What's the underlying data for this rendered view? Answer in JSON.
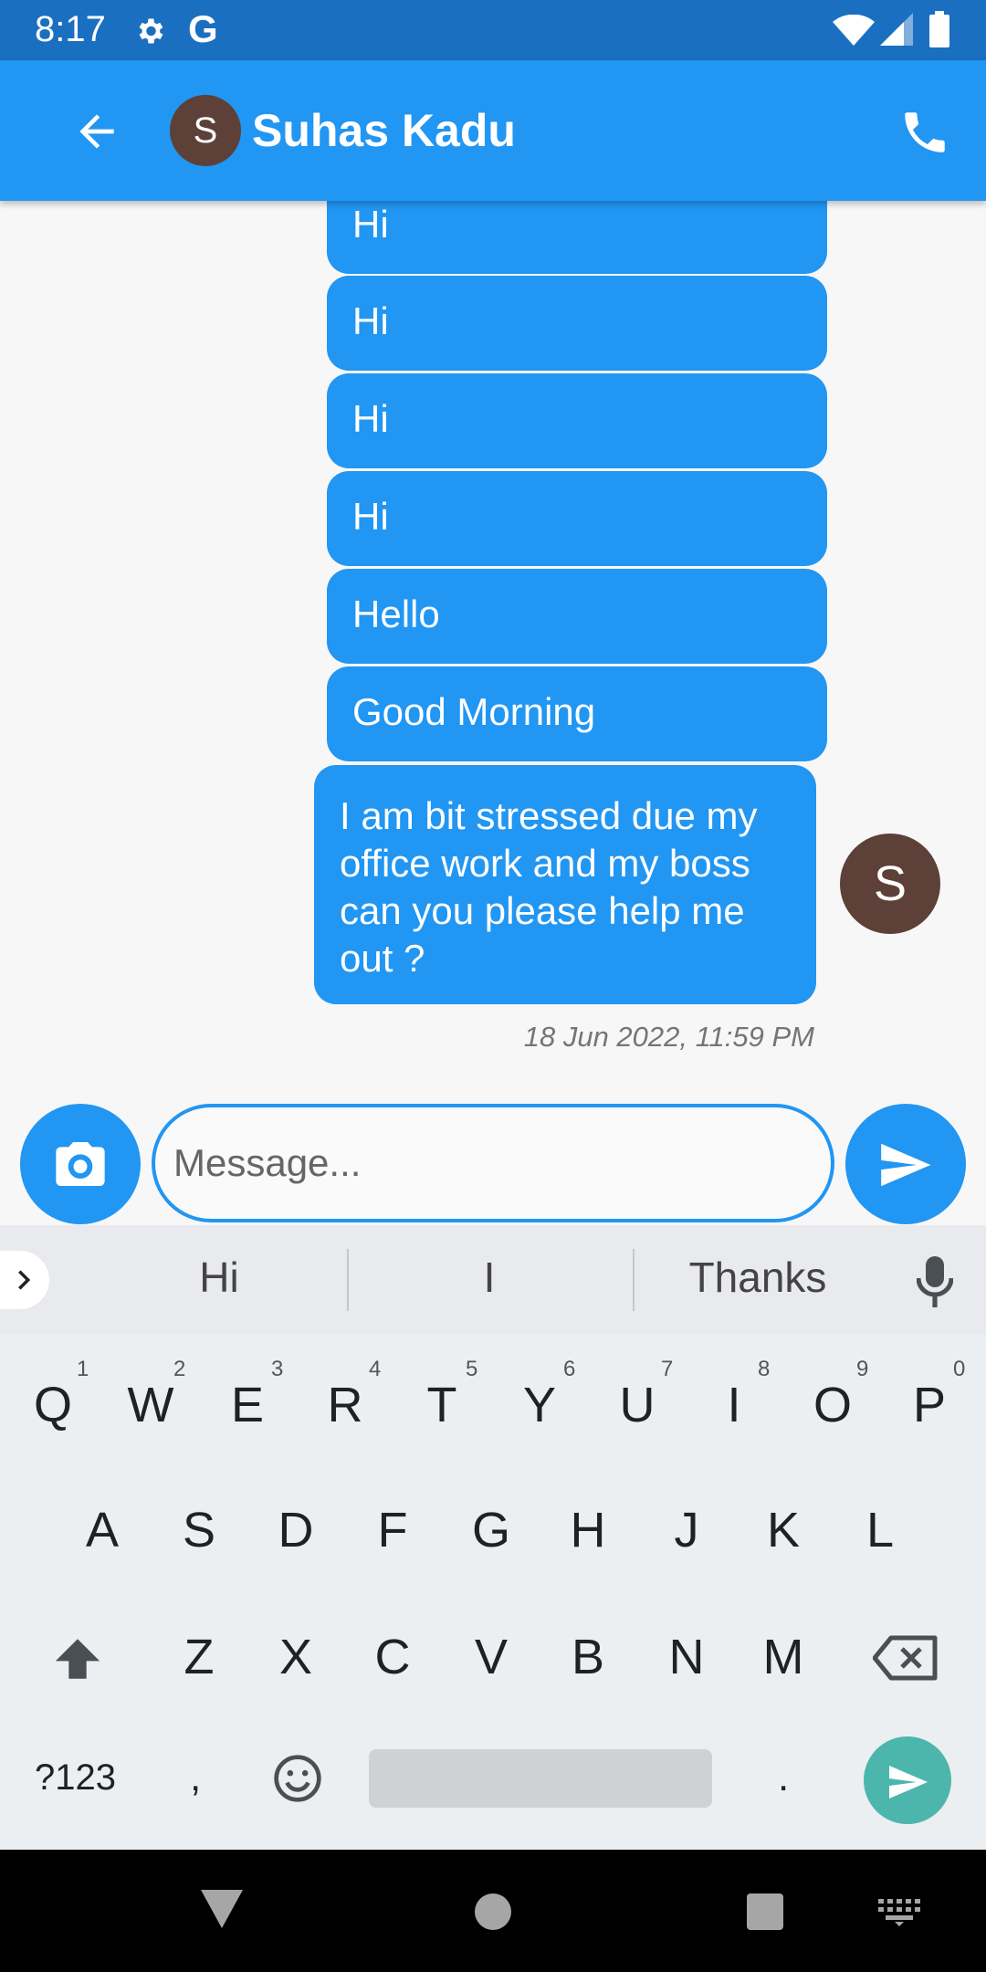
{
  "status_bar": {
    "time": "8:17",
    "g_label": "G"
  },
  "header": {
    "avatar_letter": "S",
    "title": "Suhas Kadu"
  },
  "messages": [
    {
      "text": "Hi"
    },
    {
      "text": "Hi"
    },
    {
      "text": "Hi"
    },
    {
      "text": "Hi"
    },
    {
      "text": "Hello"
    },
    {
      "text": "Good Morning"
    },
    {
      "text": "I am bit stressed due my office work and my boss can you please help me out ?"
    }
  ],
  "message_avatar_letter": "S",
  "timestamp": "18 Jun 2022, 11:59 PM",
  "composer": {
    "placeholder": "Message..."
  },
  "keyboard": {
    "suggestions": [
      "Hi",
      "I",
      "Thanks"
    ],
    "row1": [
      "Q",
      "W",
      "E",
      "R",
      "T",
      "Y",
      "U",
      "I",
      "O",
      "P"
    ],
    "row1_hints": [
      "1",
      "2",
      "3",
      "4",
      "5",
      "6",
      "7",
      "8",
      "9",
      "0"
    ],
    "row2": [
      "A",
      "S",
      "D",
      "F",
      "G",
      "H",
      "J",
      "K",
      "L"
    ],
    "row3": [
      "Z",
      "X",
      "C",
      "V",
      "B",
      "N",
      "M"
    ],
    "symbols_label": "?123",
    "comma_label": ",",
    "period_label": "."
  },
  "colors": {
    "primary": "#2196f3",
    "status_bar": "#1b6fc0",
    "avatar": "#5d4037",
    "enter": "#4db6ac"
  }
}
